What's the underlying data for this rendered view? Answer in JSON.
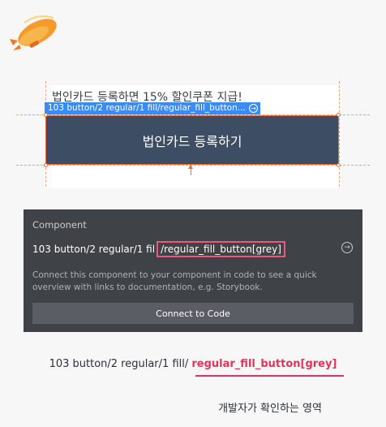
{
  "canvas": {
    "promo_text": "법인카드 등록하면 15% 할인쿠폰 지급!",
    "selection_label": "103 button/2 regular/1 fill/regular_fill_button...",
    "button_label": "법인카드 등록하기"
  },
  "panel": {
    "title": "Component",
    "path_prefix": "103 button/2 regular/1 fil",
    "path_highlight": "/regular_fill_button[grey]",
    "description": "Connect this component to your component in code to see a quick overview with links to documentation, e.g. Storybook.",
    "connect_label": "Connect to Code"
  },
  "caption": {
    "path_prefix": "103 button/2 regular/1 fill/ ",
    "path_emphasis": "regular_fill_button[grey]",
    "note": "개발자가 확인하는 영역"
  },
  "icons": {
    "logo": "zeppelin-logo",
    "go": "arrow-circle-right-icon"
  },
  "colors": {
    "accent_orange": "#f06a2e",
    "selection_blue": "#3b8bf5",
    "button_fill": "#3d4e64",
    "panel_bg": "#3f4348",
    "highlight_pink": "#e4335b"
  }
}
